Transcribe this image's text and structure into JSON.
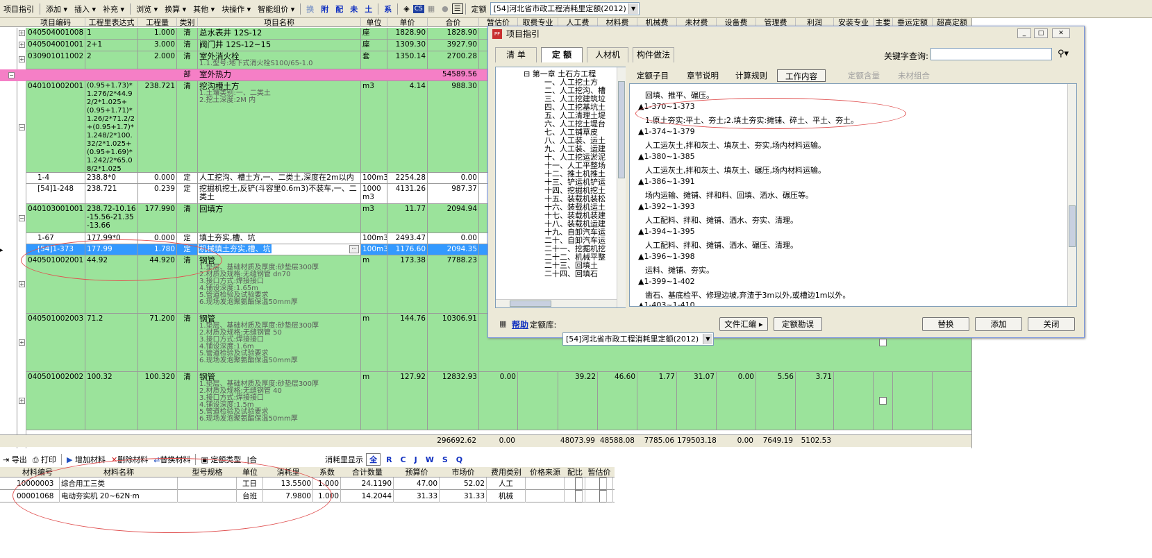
{
  "toolbar": {
    "items": [
      "项目指引",
      "添加",
      "插入",
      "补充",
      "浏览",
      "换算",
      "其他",
      "块操作",
      "智能组价"
    ],
    "mini": [
      "换",
      "附",
      "配",
      "未",
      "土",
      "系"
    ],
    "quota_label": "定额",
    "quota_value": "[54]河北省市政工程消耗里定额(2012)"
  },
  "grid": {
    "headers": [
      "项目编码",
      "工程里表达式",
      "工程量",
      "类别",
      "项目名称",
      "单位",
      "单价",
      "合价",
      "暂估价",
      "取费专业",
      "人工费",
      "材料费",
      "机械费",
      "未材费",
      "设备费",
      "管理费",
      "利润",
      "安装专业",
      "主要",
      "垂运定额",
      "超高定额"
    ],
    "rows": [
      {
        "code": "040504001008",
        "expr": "1",
        "qty": "1.000",
        "type": "清",
        "name": "总水表井 12S-12",
        "unit": "座",
        "price": "1828.90",
        "total": "1828.90"
      },
      {
        "code": "040504001001",
        "expr": "2+1",
        "qty": "3.000",
        "type": "清",
        "name": "阀门井  12S-12~15",
        "unit": "座",
        "price": "1309.30",
        "total": "3927.90"
      },
      {
        "code": "030901011002",
        "expr": "2",
        "qty": "2.000",
        "type": "清",
        "name": "室外消火栓",
        "feat": "1.1.型号:地下式消火栓S100/65-1.0",
        "unit": "套",
        "price": "1350.14",
        "total": "2700.28"
      },
      {
        "code": "",
        "expr": "",
        "qty": "",
        "type": "部",
        "name": "室外热力",
        "unit": "",
        "price": "",
        "total": "54589.56"
      },
      {
        "code": "040101002001",
        "expr": "(0.95+1.73)*1.276/2*44.92/2*1.025+(0.95+1.71)*1.26/2*71.2/2+(0.95+1.7)*1.248/2*100.32/2*1.025+(0.95+1.69)*1.242/2*65.08/2*1.025",
        "qty": "238.721",
        "type": "清",
        "name": "挖沟槽土方",
        "feat": "1.土壤类别:一、二类土\n2.挖土深度:2M 内",
        "unit": "m3",
        "price": "4.14",
        "total": "988.30"
      },
      {
        "code": "1-4",
        "expr": "238.8*0",
        "qty": "0.000",
        "type": "定",
        "name": "人工挖沟、槽土方,一、二类土,深度在2m以内",
        "unit": "100m3",
        "price": "2254.28",
        "total": "0.00"
      },
      {
        "code": "[54]1-248",
        "expr": "238.721",
        "qty": "0.239",
        "type": "定",
        "name": "挖掘机挖土,反铲(斗容里0.6m3)不装车,一、二类土",
        "unit": "1000m3",
        "price": "4131.26",
        "total": "987.37"
      },
      {
        "code": "040103001001",
        "expr": "238.72-10.16-15.56-21.35-13.66",
        "qty": "177.990",
        "type": "清",
        "name": "回填方",
        "unit": "m3",
        "price": "11.77",
        "total": "2094.94"
      },
      {
        "code": "1-67",
        "expr": "177.99*0",
        "qty": "0.000",
        "type": "定",
        "name": "填土夯实,槽、坑",
        "unit": "100m3",
        "price": "2493.47",
        "total": "0.00"
      },
      {
        "code": "[54]1-373",
        "expr": "177.99",
        "qty": "1.780",
        "type": "定",
        "name": "机械填土夯实,槽、坑",
        "unit": "100m3",
        "price": "1176.60",
        "total": "2094.35"
      },
      {
        "code": "040501002001",
        "expr": "44.92",
        "qty": "44.920",
        "type": "清",
        "name": "钢管",
        "feat": "1.垫层、基础材质及厚度:砂垫层300厚\n2.材质及规格:无缝钢管 dn70\n3.接口方式:焊接接口\n4.铺设深度:1.65m\n5.管道检验及试验要求\n6.现场发泡聚氨酯保温50mm厚",
        "unit": "m",
        "price": "173.38",
        "total": "7788.23"
      },
      {
        "code": "040501002003",
        "expr": "71.2",
        "qty": "71.200",
        "type": "清",
        "name": "钢管",
        "feat": "1.垫层、基础材质及厚度:砂垫层300厚\n2.材质及规格:无缝钢管 50\n3.接口方式:焊接接口\n4.铺设深度:1.6m\n5.管道检验及试验要求\n6.现场发泡聚氨酯保温50mm厚",
        "unit": "m",
        "price": "144.76",
        "total": "10306.91"
      },
      {
        "code": "040501002002",
        "expr": "100.32",
        "qty": "100.320",
        "type": "清",
        "name": "钢管",
        "feat": "1.垫层、基础材质及厚度:砂垫层300厚\n2.材质及规格:无缝钢管 40\n3.接口方式:焊接接口\n4.铺设深度:1.5m\n5.管道检验及试验要求\n6.现场发泡聚氨酯保温50mm厚",
        "unit": "m",
        "price": "127.92",
        "total": "12832.93",
        "est": "0.00",
        "labor": "39.22",
        "material": "46.60",
        "machine": "1.77",
        "unmat": "31.07",
        "equip": "0.00",
        "mgmt": "5.56",
        "profit": "3.71"
      }
    ],
    "summary": {
      "total": "296692.62",
      "est": "0.00",
      "labor": "48073.99",
      "material": "48588.08",
      "machine": "7785.06",
      "unmat": "179503.18",
      "equip": "0.00",
      "mgmt": "7649.19",
      "profit": "5102.53"
    }
  },
  "dialog": {
    "title": "项目指引",
    "tabs": [
      "清 单",
      "定 额",
      "人材机",
      "构件做法"
    ],
    "search_label": "关键字查询:",
    "tree": [
      "第一章 土石方工程",
      "一、人工挖土方",
      "二、人工挖沟、槽",
      "三、人工挖建筑垃",
      "四、人工挖基坑土",
      "五、人工清理土堤",
      "六、人工挖土堤台",
      "七、人工铺草皮",
      "八、人工装、运土",
      "九、人工装、运建",
      "十、人工挖运淤泥",
      "十一、人工平整场",
      "十二、推土机推土",
      "十三、铲运机铲运",
      "十四、挖掘机挖土",
      "十五、装载机装松",
      "十六、装载机运土",
      "十七、装载机装建",
      "十八、装载机运建",
      "十九、自卸汽车运",
      "二十、自卸汽车运",
      "二十一、挖掘机挖",
      "二十二、机械平整",
      "二十三、回填土",
      "二十四、回填石"
    ],
    "subtabs": [
      "定额子目",
      "章节说明",
      "计算规则",
      "工作内容",
      "定额含量",
      "未材组合"
    ],
    "content": [
      "回填、推平、碾压。",
      "▲1-370~1-373",
      "1.原土夯实:平土、夯土;2.填土夯实:摊铺、碎土、平土、夯土。",
      "▲1-374~1-379",
      "人工运灰土,拌和灰土、填灰土、夯实,场内材料运输。",
      "▲1-380~1-385",
      "人工运灰土,拌和灰土、填灰土、碾压,场内材料运输。",
      "▲1-386~1-391",
      "场内运输、摊铺、拌和料、回填、洒水、碾压等。",
      "▲1-392~1-393",
      "人工配料、拌和、摊铺、洒水、夯实、清理。",
      "▲1-394~1-395",
      "人工配料、拌和、摊铺、洒水、碾压、清理。",
      "▲1-396~1-398",
      "运料、摊铺、夯实。",
      "▲1-399~1-402",
      "凿石、基底检平、修理边坡,弃渣于3m以外,或槽边1m以外。",
      "▲1-403~1-410"
    ],
    "help": "帮助",
    "lib_label": "定额库:",
    "lib_value": "[54]河北省市政工程消耗里定额(2012)",
    "btn_file": "文件汇编",
    "btn_errata": "定额勘误",
    "btn_replace": "替换",
    "btn_add": "添加",
    "btn_close": "关闭"
  },
  "bottom": {
    "toolbar": [
      "导出",
      "打印",
      "增加材料",
      "删除材料",
      "替换材料",
      "定额类型",
      "|合"
    ],
    "display_label": "消耗里显示",
    "filters": [
      "全",
      "R",
      "C",
      "J",
      "W",
      "S",
      "Q"
    ],
    "headers": [
      "材料编号",
      "材料名称",
      "型号规格",
      "单位",
      "消耗里",
      "系数",
      "合计数量",
      "预算价",
      "市场价",
      "费用类别",
      "价格来源",
      "配比",
      "暂估价"
    ],
    "rows": [
      {
        "code": "10000003",
        "name": "综合用工三类",
        "spec": "",
        "unit": "工日",
        "amount": "13.5500",
        "coef": "1.000",
        "sum": "24.1190",
        "budget": "47.00",
        "market": "52.02",
        "category": "人工"
      },
      {
        "code": "00001068",
        "name": "电动夯实机 20~62N·m",
        "spec": "",
        "unit": "台班",
        "amount": "7.9800",
        "coef": "1.000",
        "sum": "14.2044",
        "budget": "31.33",
        "market": "31.33",
        "category": "机械"
      }
    ]
  }
}
